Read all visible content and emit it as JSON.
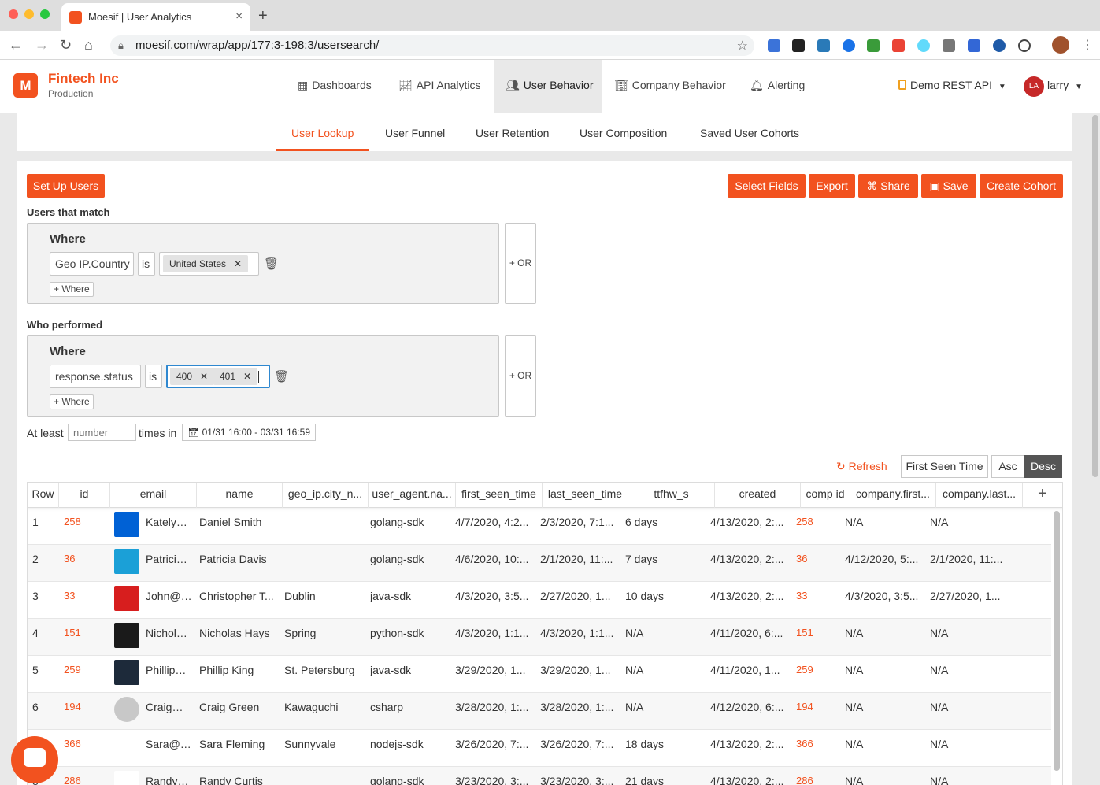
{
  "browser": {
    "tab_title": "Moesif | User Analytics",
    "tab_close": "×",
    "new_tab": "+",
    "url": "moesif.com/wrap/app/177:3-198:3/usersearch/"
  },
  "org": {
    "logo_letter": "M",
    "name": "Fintech Inc",
    "env": "Production"
  },
  "nav": [
    {
      "label": "Dashboards",
      "icon": "dashboard-icon"
    },
    {
      "label": "API Analytics",
      "icon": "chart-icon"
    },
    {
      "label": "User Behavior",
      "icon": "users-icon"
    },
    {
      "label": "Company Behavior",
      "icon": "building-icon"
    },
    {
      "label": "Alerting",
      "icon": "bell-icon"
    }
  ],
  "app_env": "Demo REST API",
  "user": {
    "initials": "LA",
    "name": "larry"
  },
  "subnav": [
    "User Lookup",
    "User Funnel",
    "User Retention",
    "User Composition",
    "Saved User Cohorts"
  ],
  "actions": {
    "setup": "Set Up Users",
    "select_fields": "Select Fields",
    "export": "Export",
    "share": "Share",
    "save": "Save",
    "create_cohort": "Create Cohort"
  },
  "filters": {
    "users_match_label": "Users that match",
    "users_where": {
      "title": "Where",
      "field": "Geo IP.Country",
      "op": "is",
      "values": [
        "United States"
      ],
      "add": "+ Where",
      "or": "+ OR"
    },
    "performed_label": "Who performed",
    "performed_where": {
      "title": "Where",
      "field": "response.status",
      "op": "is",
      "values": [
        "400",
        "401"
      ],
      "add": "+ Where",
      "or": "+ OR"
    },
    "at_least": "At least",
    "number_placeholder": "number",
    "times_in": "times in",
    "date_range": "01/31 16:00 - 03/31 16:59"
  },
  "sort": {
    "refresh": "Refresh",
    "field": "First Seen Time",
    "asc": "Asc",
    "desc": "Desc"
  },
  "table": {
    "columns": [
      "Row",
      "id",
      "email",
      "name",
      "geo_ip.city_n...",
      "user_agent.na...",
      "first_seen_time",
      "last_seen_time",
      "ttfhw_s",
      "created",
      "comp id",
      "company.first...",
      "company.last..."
    ],
    "add_column": "+",
    "rows": [
      {
        "row": "1",
        "id": "258",
        "logo": "box",
        "email": "Katelyn@l",
        "name": "Daniel Smith",
        "city": "",
        "agent": "golang-sdk",
        "first": "4/7/2020, 4:2...",
        "last": "2/3/2020, 7:1...",
        "ttfhw": "6 days",
        "created": "4/13/2020, 2:...",
        "comp_id": "258",
        "cfirst": "N/A",
        "clast": "N/A"
      },
      {
        "row": "2",
        "id": "36",
        "logo": "cisco",
        "email": "Patricia@",
        "name": "Patricia Davis",
        "city": "",
        "agent": "golang-sdk",
        "first": "4/6/2020, 10:...",
        "last": "2/1/2020, 11:...",
        "ttfhw": "7 days",
        "created": "4/13/2020, 2:...",
        "comp_id": "36",
        "cfirst": "4/12/2020, 5:...",
        "clast": "2/1/2020, 11:..."
      },
      {
        "row": "3",
        "id": "33",
        "logo": "runner",
        "email": "John@Ou",
        "name": "Christopher T...",
        "city": "Dublin",
        "agent": "java-sdk",
        "first": "4/3/2020, 3:5...",
        "last": "2/27/2020, 1...",
        "ttfhw": "10 days",
        "created": "4/13/2020, 2:...",
        "comp_id": "33",
        "cfirst": "4/3/2020, 3:5...",
        "clast": "2/27/2020, 1..."
      },
      {
        "row": "4",
        "id": "151",
        "logo": "auth",
        "email": "Nicholas@",
        "name": "Nicholas Hays",
        "city": "Spring",
        "agent": "python-sdk",
        "first": "4/3/2020, 1:1...",
        "last": "4/3/2020, 1:1...",
        "ttfhw": "N/A",
        "created": "4/11/2020, 6:...",
        "comp_id": "151",
        "cfirst": "N/A",
        "clast": "N/A"
      },
      {
        "row": "5",
        "id": "259",
        "logo": "dash",
        "email": "Phillip@D",
        "name": "Phillip King",
        "city": "St. Petersburg",
        "agent": "java-sdk",
        "first": "3/29/2020, 1...",
        "last": "3/29/2020, 1...",
        "ttfhw": "N/A",
        "created": "4/11/2020, 1...",
        "comp_id": "259",
        "cfirst": "N/A",
        "clast": "N/A"
      },
      {
        "row": "6",
        "id": "194",
        "logo": "generic",
        "email": "Craig@Te",
        "name": "Craig Green",
        "city": "Kawaguchi",
        "agent": "csharp",
        "first": "3/28/2020, 1:...",
        "last": "3/28/2020, 1:...",
        "ttfhw": "N/A",
        "created": "4/12/2020, 6:...",
        "comp_id": "194",
        "cfirst": "N/A",
        "clast": "N/A"
      },
      {
        "row": "7",
        "id": "366",
        "logo": "equifax",
        "email": "Sara@equ",
        "name": "Sara Fleming",
        "city": "Sunnyvale",
        "agent": "nodejs-sdk",
        "first": "3/26/2020, 7:...",
        "last": "3/26/2020, 7:...",
        "ttfhw": "18 days",
        "created": "4/13/2020, 2:...",
        "comp_id": "366",
        "cfirst": "N/A",
        "clast": "N/A"
      },
      {
        "row": "8",
        "id": "286",
        "logo": "snow",
        "email": "Randy@sr",
        "name": "Randy Curtis",
        "city": "",
        "agent": "golang-sdk",
        "first": "3/23/2020, 3:...",
        "last": "3/23/2020, 3:...",
        "ttfhw": "21 days",
        "created": "4/13/2020, 2:...",
        "comp_id": "286",
        "cfirst": "N/A",
        "clast": "N/A"
      }
    ]
  },
  "colors": {
    "accent": "#f2521f"
  }
}
